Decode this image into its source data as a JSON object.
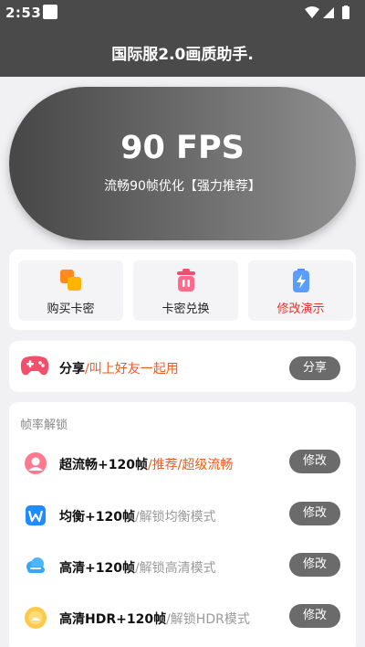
{
  "status_bar": {
    "time": "2:53"
  },
  "header": {
    "title": "国际服2.0画质助手."
  },
  "hero": {
    "title": "90 FPS",
    "subtitle": "流畅90帧优化【强力推荐】"
  },
  "actions": [
    {
      "label": "购买卡密",
      "icon": "stacked-cards-icon"
    },
    {
      "label": "卡密兑换",
      "icon": "trash-box-icon"
    },
    {
      "label": "修改演示",
      "icon": "battery-bolt-icon"
    }
  ],
  "share": {
    "title": "分享",
    "desc": "/叫上好友一起用",
    "button": "分享"
  },
  "frame_rate": {
    "section_title": "帧率解锁",
    "items": [
      {
        "title": "超流畅+120帧",
        "desc": "/推荐/超级流畅",
        "button": "修改",
        "icon": "pink-avatar-icon"
      },
      {
        "title": "均衡+120帧",
        "desc": "/解锁均衡模式",
        "button": "修改",
        "icon": "blue-w-icon"
      },
      {
        "title": "高清+120帧",
        "desc": "/解锁高清模式",
        "button": "修改",
        "icon": "cloud-icon"
      },
      {
        "title": "高清HDR+120帧",
        "desc": "/解锁HDR模式",
        "button": "修改",
        "icon": "sun-icon"
      }
    ]
  },
  "colors": {
    "accent_orange": "#ef5a1e",
    "demo_red": "#e8322a",
    "header_bg": "#4a4a4a",
    "button_bg": "#6b6b6b"
  }
}
